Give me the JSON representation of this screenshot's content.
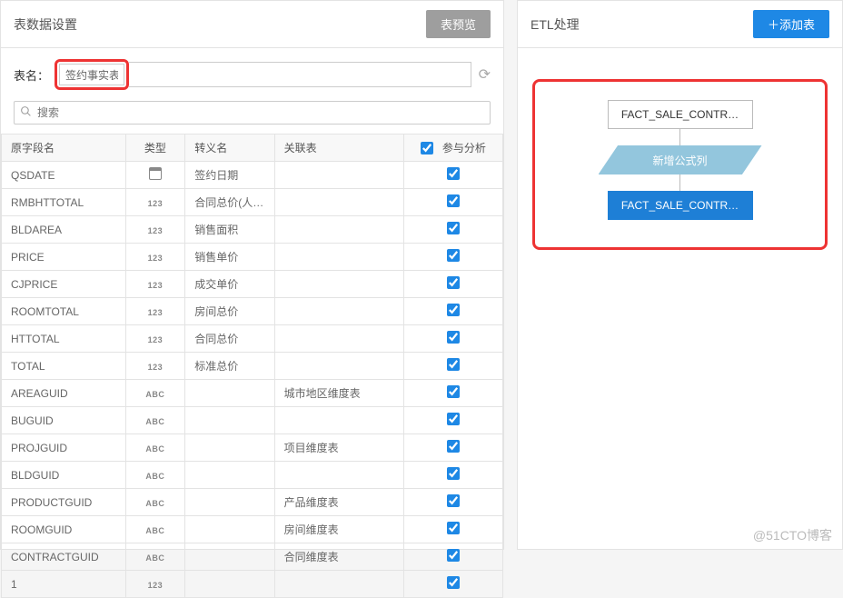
{
  "leftPanel": {
    "title": "表数据设置",
    "previewBtn": "表预览",
    "tableNameLabel": "表名：",
    "tableNameValue": "签约事实表",
    "searchPlaceholder": "搜索",
    "columns": {
      "fieldName": "原字段名",
      "type": "类型",
      "alias": "转义名",
      "relTable": "关联表",
      "analyze": "参与分析"
    },
    "rows": [
      {
        "field": "QSDATE",
        "type": "date",
        "alias": "签约日期",
        "rel": "",
        "checked": true
      },
      {
        "field": "RMBHTTOTAL",
        "type": "123",
        "alias": "合同总价(人…",
        "rel": "",
        "checked": true
      },
      {
        "field": "BLDAREA",
        "type": "123",
        "alias": "销售面积",
        "rel": "",
        "checked": true
      },
      {
        "field": "PRICE",
        "type": "123",
        "alias": "销售单价",
        "rel": "",
        "checked": true
      },
      {
        "field": "CJPRICE",
        "type": "123",
        "alias": "成交单价",
        "rel": "",
        "checked": true
      },
      {
        "field": "ROOMTOTAL",
        "type": "123",
        "alias": "房间总价",
        "rel": "",
        "checked": true
      },
      {
        "field": "HTTOTAL",
        "type": "123",
        "alias": "合同总价",
        "rel": "",
        "checked": true
      },
      {
        "field": "TOTAL",
        "type": "123",
        "alias": "标准总价",
        "rel": "",
        "checked": true
      },
      {
        "field": "AREAGUID",
        "type": "ABC",
        "alias": "",
        "rel": "城市地区维度表",
        "checked": true
      },
      {
        "field": "BUGUID",
        "type": "ABC",
        "alias": "",
        "rel": "",
        "checked": true
      },
      {
        "field": "PROJGUID",
        "type": "ABC",
        "alias": "",
        "rel": "项目维度表",
        "checked": true
      },
      {
        "field": "BLDGUID",
        "type": "ABC",
        "alias": "",
        "rel": "",
        "checked": true
      },
      {
        "field": "PRODUCTGUID",
        "type": "ABC",
        "alias": "",
        "rel": "产品维度表",
        "checked": true
      },
      {
        "field": "ROOMGUID",
        "type": "ABC",
        "alias": "",
        "rel": "房间维度表",
        "checked": true
      },
      {
        "field": "CONTRACTGUID",
        "type": "ABC",
        "alias": "",
        "rel": "合同维度表",
        "checked": true
      },
      {
        "field": "1",
        "type": "123",
        "alias": "",
        "rel": "",
        "checked": true
      }
    ]
  },
  "rightPanel": {
    "title": "ETL处理",
    "addBtn": "＋添加表",
    "flow": {
      "node1": "FACT_SALE_CONTR…",
      "node2": "新增公式列",
      "node3": "FACT_SALE_CONTR…"
    }
  },
  "watermark": "@51CTO博客"
}
